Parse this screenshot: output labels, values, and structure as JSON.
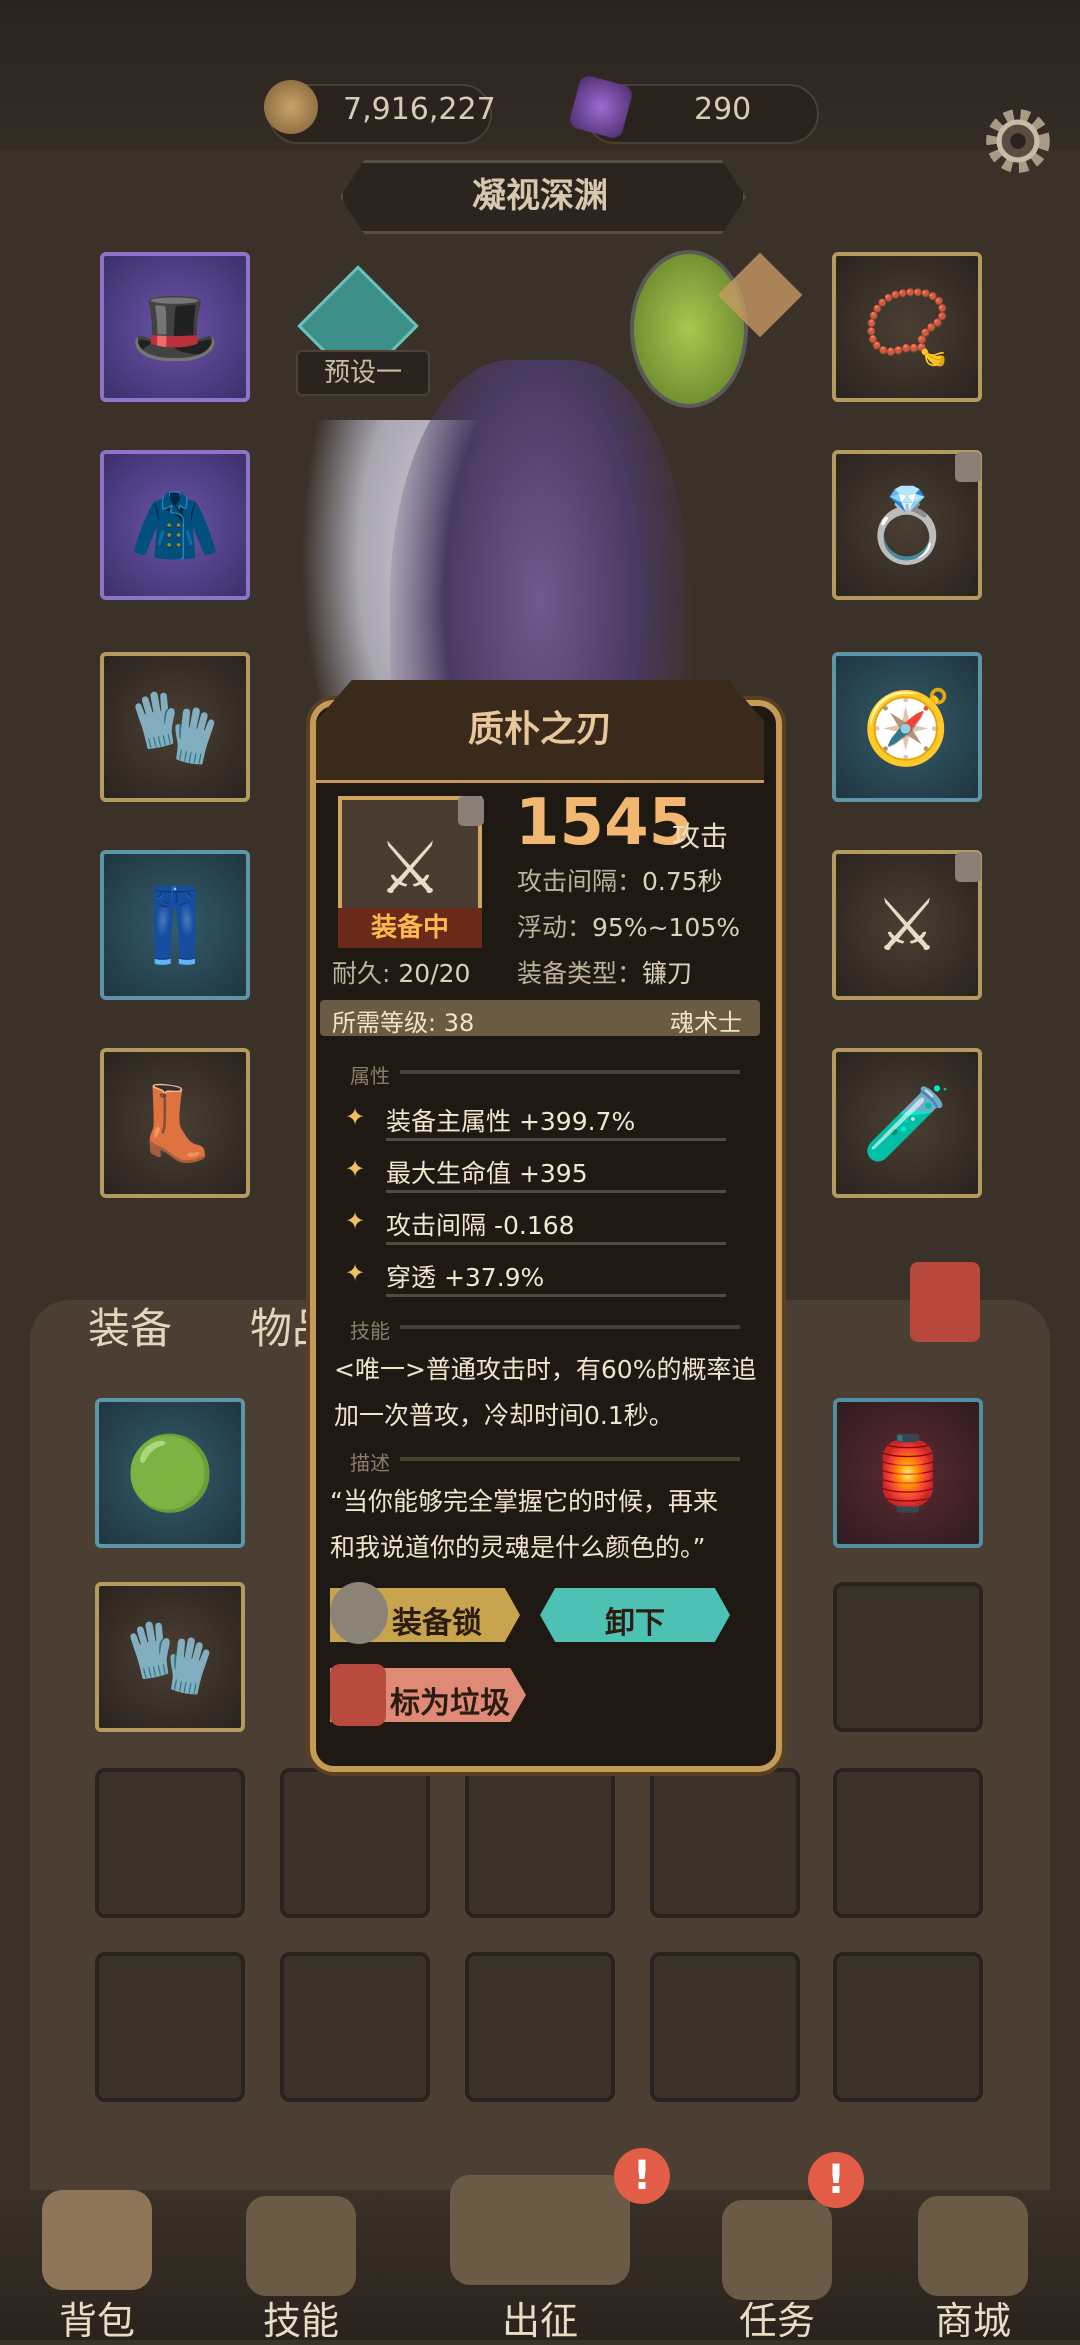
{
  "header": {
    "gold_amount": "7,916,227",
    "gem_amount": "290",
    "title": "凝视深渊"
  },
  "preset": {
    "label": "预设一"
  },
  "bag": {
    "tabs": [
      "装备",
      "物品"
    ]
  },
  "popup": {
    "name": "质朴之刃",
    "equipped_tag": "装备中",
    "attack_value": "1545",
    "attack_unit": "攻击",
    "stats": [
      {
        "label": "攻击间隔：",
        "value": "0.75秒"
      },
      {
        "label": "浮动：",
        "value": "95%~105%"
      },
      {
        "label": "装备类型：",
        "value": "镰刀"
      }
    ],
    "durability_label": "耐久:",
    "durability_value": "20/20",
    "required_level_label": "所需等级:",
    "required_level_value": "38",
    "class_name": "魂术士",
    "section_attributes": "属性",
    "attributes": [
      "装备主属性 +399.7%",
      "最大生命值 +395",
      "攻击间隔 -0.168",
      "穿透 +37.9%"
    ],
    "section_skill": "技能",
    "skill_text_line1": "<唯一>普通攻击时，有60%的概率追",
    "skill_text_line2": "加一次普攻，冷却时间0.1秒。",
    "section_desc": "描述",
    "desc_line1": "“当你能够完全掌握它的时候，再来",
    "desc_line2": "和我说道你的灵魂是什么颜色的。”",
    "btn_lock": "装备锁",
    "btn_unequip": "卸下",
    "btn_junk": "标为垃圾"
  },
  "nav": {
    "items": [
      "背包",
      "技能",
      "出征",
      "任务",
      "商城"
    ],
    "alert_mark": "!"
  },
  "colors": {
    "gold_text": "#f2b871",
    "teal_button": "#4ec1b5",
    "frame_gold": "#c39a56"
  }
}
